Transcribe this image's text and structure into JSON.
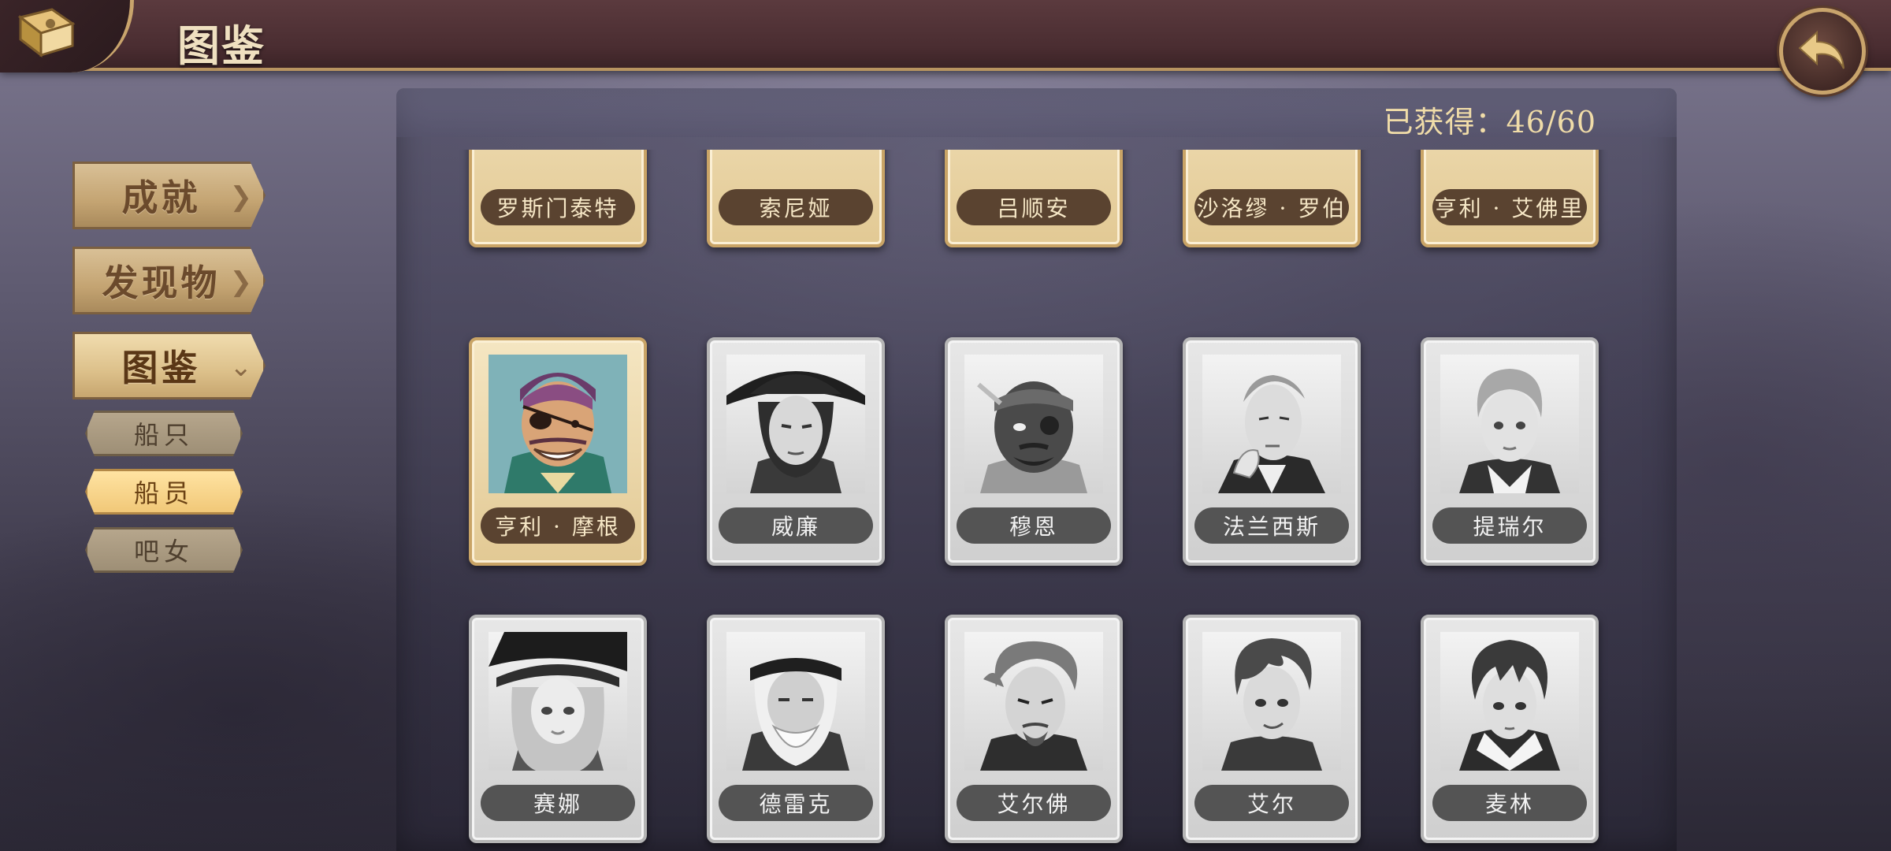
{
  "header": {
    "title": "图鉴",
    "book_icon": "book-icon",
    "back_icon": "back-arrow-icon"
  },
  "sidebar": {
    "tabs": [
      {
        "label": "成就",
        "active": false
      },
      {
        "label": "发现物",
        "active": false
      },
      {
        "label": "图鉴",
        "active": true
      }
    ],
    "subtabs": [
      {
        "label": "船只",
        "active": false
      },
      {
        "label": "船员",
        "active": true
      },
      {
        "label": "吧女",
        "active": false
      }
    ]
  },
  "panel": {
    "collected_text": "已获得：46/60"
  },
  "cards_partial": [
    "罗斯门泰特",
    "索尼娅",
    "吕顺安",
    "巴沙洛缪 · 罗伯茨",
    "亨利 · 艾佛里"
  ],
  "cards": [
    {
      "name": "亨利 · 摩根",
      "unlocked": true
    },
    {
      "name": "威廉",
      "unlocked": false
    },
    {
      "name": "穆恩",
      "unlocked": false
    },
    {
      "name": "法兰西斯",
      "unlocked": false
    },
    {
      "name": "提瑞尔",
      "unlocked": false
    },
    {
      "name": "赛娜",
      "unlocked": false
    },
    {
      "name": "德雷克",
      "unlocked": false
    },
    {
      "name": "艾尔佛",
      "unlocked": false
    },
    {
      "name": "艾尔",
      "unlocked": false
    },
    {
      "name": "麦林",
      "unlocked": false
    }
  ],
  "colors": {
    "header_bg": "#4a2d31",
    "gold_accent": "#c9a46c",
    "unlocked_card": "#e2c994",
    "locked_card": "#d4d4d4"
  }
}
